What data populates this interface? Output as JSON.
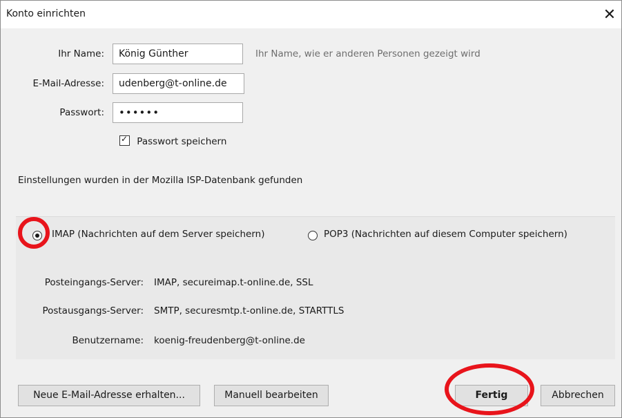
{
  "window": {
    "title": "Konto einrichten",
    "close_symbol": "✕"
  },
  "form": {
    "name_label": "Ihr Name:",
    "name_value": "König Günther",
    "name_hint": "Ihr Name, wie er anderen Personen gezeigt wird",
    "email_label": "E-Mail-Adresse:",
    "email_value": "udenberg@t-online.de",
    "password_label": "Passwort:",
    "password_value": "••••••",
    "remember_password_label": "Passwort speichern",
    "remember_password_checked": true
  },
  "status_text": "Einstellungen wurden in der Mozilla ISP-Datenbank gefunden",
  "protocol": {
    "imap_label": "IMAP (Nachrichten auf dem Server speichern)",
    "pop3_label": "POP3 (Nachrichten auf diesem Computer speichern)",
    "selected": "IMAP"
  },
  "servers": {
    "incoming_label": "Posteingangs-Server:",
    "incoming_value": "IMAP, secureimap.t-online.de, SSL",
    "outgoing_label": "Postausgangs-Server:",
    "outgoing_value": "SMTP, securesmtp.t-online.de, STARTTLS",
    "username_label": "Benutzername:",
    "username_value": "koenig-freudenberg@t-online.de"
  },
  "buttons": {
    "new_email": "Neue E-Mail-Adresse erhalten...",
    "manual_edit": "Manuell bearbeiten",
    "done": "Fertig",
    "cancel": "Abbrechen"
  },
  "colors": {
    "annotation_red": "#e8141b",
    "background": "#f0f0f0"
  }
}
